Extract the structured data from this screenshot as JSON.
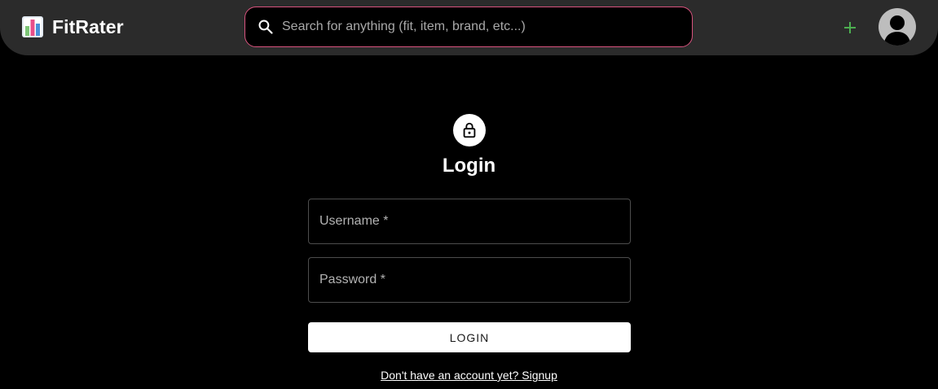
{
  "header": {
    "brand": {
      "name": "FitRater",
      "logo_icon": "bar-chart-icon"
    },
    "search": {
      "placeholder": "Search for anything (fit, item, brand, etc...)",
      "value": "",
      "icon": "search-icon"
    },
    "add_button": {
      "icon": "plus-icon"
    },
    "avatar": {
      "icon": "person-icon"
    }
  },
  "login": {
    "icon": "lock-icon",
    "title": "Login",
    "username": {
      "placeholder": "Username *",
      "value": ""
    },
    "password": {
      "placeholder": "Password *",
      "value": ""
    },
    "submit_label": "LOGIN",
    "signup_link": "Don't have an account yet? Signup"
  },
  "colors": {
    "background": "#000000",
    "header_bg": "#2b2b2b",
    "search_border": "#d9537e",
    "add_icon": "#4caf50",
    "text": "#ffffff"
  }
}
